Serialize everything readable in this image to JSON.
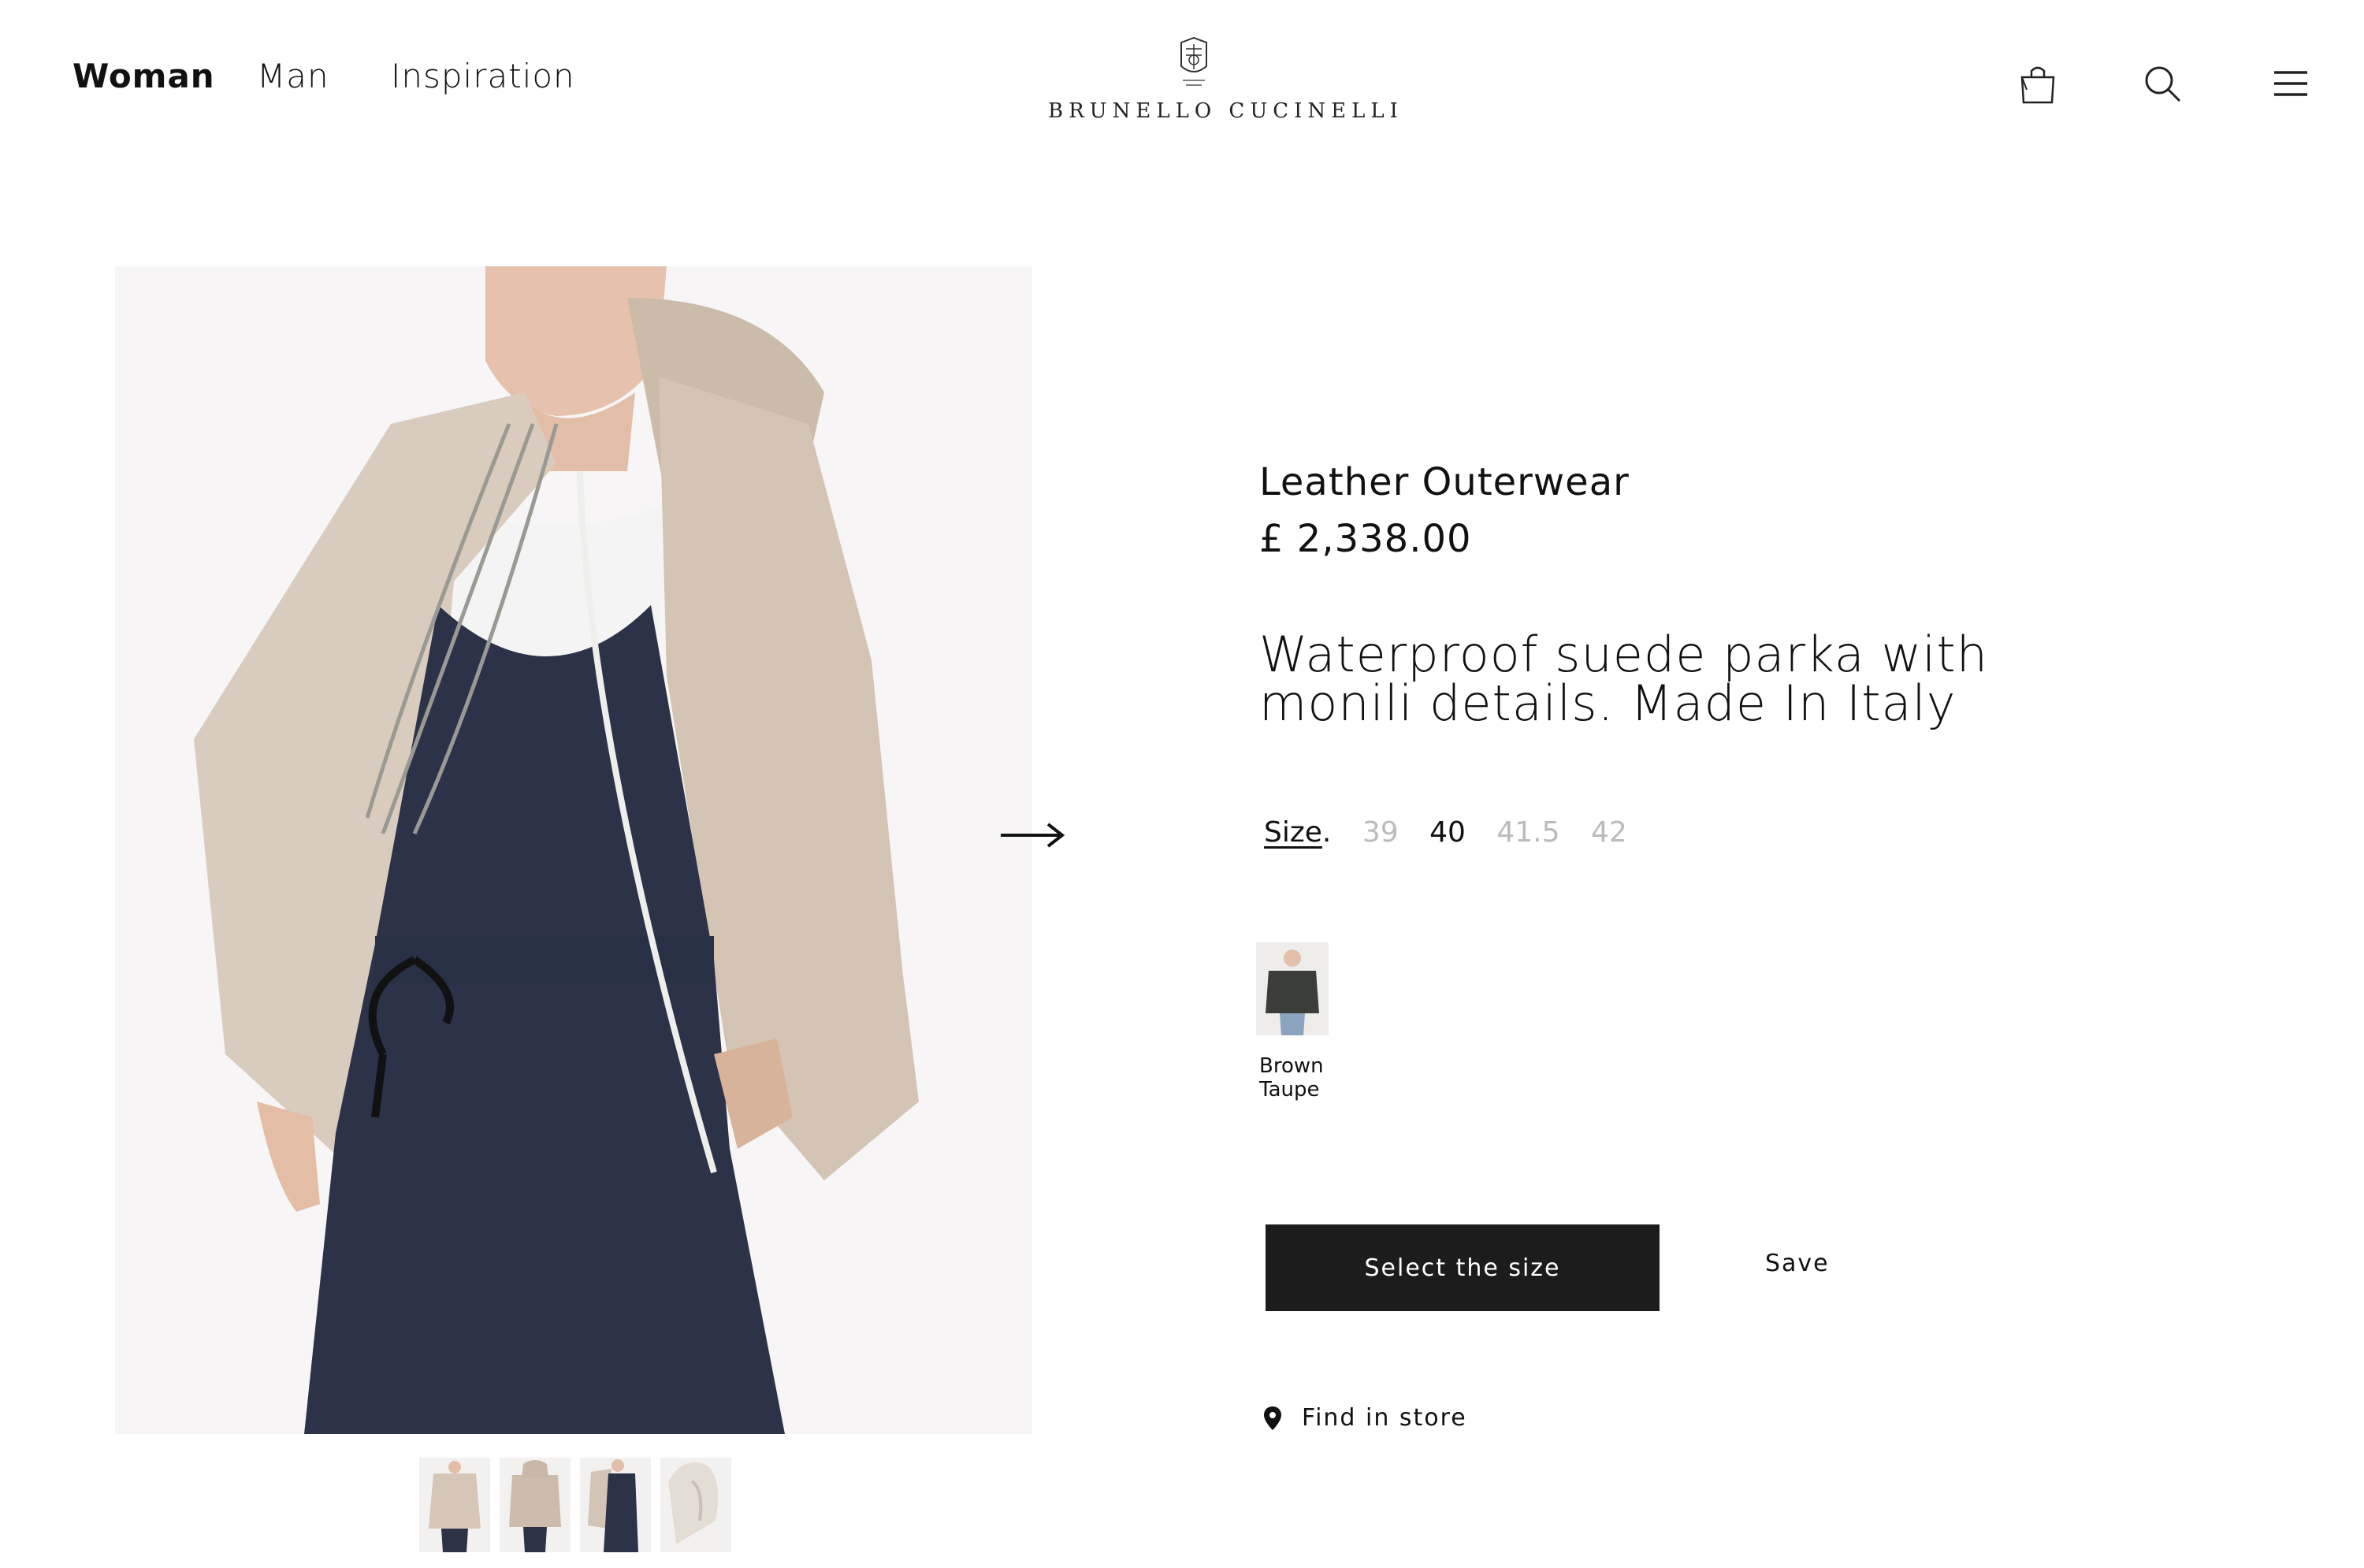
{
  "header": {
    "nav": [
      {
        "label": "Woman",
        "active": true
      },
      {
        "label": "Man",
        "active": false
      },
      {
        "label": "Inspiration",
        "active": false
      }
    ],
    "logo_text": "BRUNELLO CUCINELLI",
    "icons": [
      "shopping-bag-icon",
      "search-icon",
      "menu-icon"
    ]
  },
  "product": {
    "name": "Leather Outerwear",
    "price": "£ 2,338.00",
    "description": "Waterproof suede parka with monili details. Made In Italy",
    "size_label": "Size",
    "sizes": [
      {
        "label": "39",
        "available": false
      },
      {
        "label": "40",
        "available": true
      },
      {
        "label": "41.5",
        "available": false
      },
      {
        "label": "42",
        "available": false
      }
    ],
    "color_swatch_label": "Brown Taupe",
    "select_size_label": "Select the size",
    "save_label": "Save",
    "find_in_store_label": "Find in store"
  },
  "colors": {
    "button_bg": "#1c1c1c",
    "text": "#111111",
    "unavailable_size": "#bbbbbb",
    "jacket": "#d6c8ba",
    "jumpsuit": "#2c3348"
  }
}
